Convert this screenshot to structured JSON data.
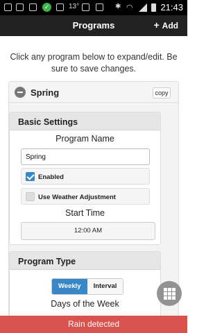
{
  "status_bar": {
    "temperature": "13°",
    "time": "21:43"
  },
  "header": {
    "title": "Programs",
    "add_label": "Add",
    "add_icon": "plus-icon"
  },
  "intro_text": "Click any program below to expand/edit. Be sure to save changes.",
  "program": {
    "name": "Spring",
    "copy_label": "copy",
    "basic_settings": {
      "title": "Basic Settings",
      "program_name_label": "Program Name",
      "program_name_value": "Spring",
      "enabled_label": "Enabled",
      "enabled_checked": true,
      "weather_label": "Use Weather Adjustment",
      "weather_checked": false,
      "start_time_label": "Start Time",
      "start_time_value": "12:00 AM"
    },
    "program_type": {
      "title": "Program Type",
      "options": [
        "Weekly",
        "Interval"
      ],
      "selected": "Weekly",
      "days_label": "Days of the Week"
    }
  },
  "toast": {
    "message": "Rain detected",
    "color": "#d9534f"
  },
  "colors": {
    "accent": "#3a87c7",
    "header_bg": "#222222"
  }
}
